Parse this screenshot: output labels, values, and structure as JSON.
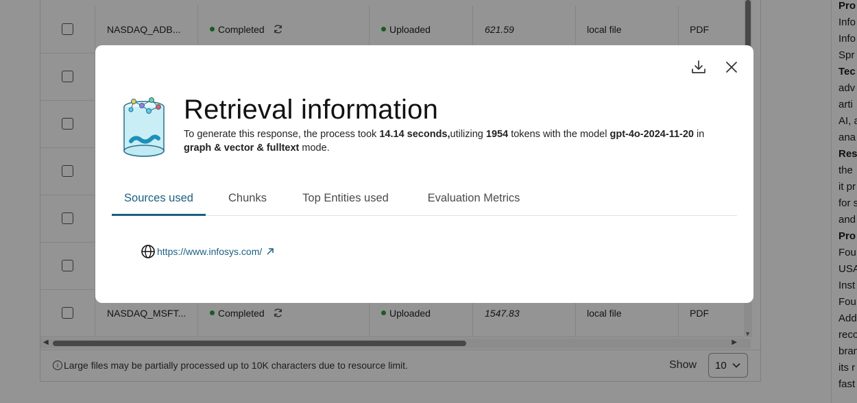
{
  "table": {
    "rows": [
      {
        "checked": false,
        "name": "NASDAQ_ADB...",
        "status": "Completed",
        "upload": "Uploaded",
        "size": "621.59",
        "source": "local file",
        "type": "PDF"
      },
      {
        "checked": false,
        "name": "",
        "status": "",
        "upload": "",
        "size": "",
        "source": "",
        "type": ""
      },
      {
        "checked": false,
        "name": "",
        "status": "",
        "upload": "",
        "size": "",
        "source": "",
        "type": ""
      },
      {
        "checked": false,
        "name": "",
        "status": "",
        "upload": "",
        "size": "",
        "source": "",
        "type": ""
      },
      {
        "checked": false,
        "name": "",
        "status": "",
        "upload": "",
        "size": "",
        "source": "",
        "type": ""
      },
      {
        "checked": false,
        "name": "",
        "status": "",
        "upload": "",
        "size": "",
        "source": "",
        "type": ""
      },
      {
        "checked": false,
        "name": "NASDAQ_MSFT...",
        "status": "Completed",
        "upload": "Uploaded",
        "size": "1547.83",
        "source": "local file",
        "type": "PDF"
      }
    ],
    "status_color": "#2e9e3f"
  },
  "footer": {
    "note": "Large files may be partially processed up to 10K characters due to resource limit.",
    "show_label": "Show",
    "page_size": "10"
  },
  "right_panel": {
    "lines": [
      {
        "text": "Pro",
        "bold": true
      },
      {
        "text": "Info",
        "bold": false
      },
      {
        "text": "Info",
        "bold": false
      },
      {
        "text": "Spr",
        "bold": false
      },
      {
        "text": "Tec",
        "bold": true
      },
      {
        "text": "adv",
        "bold": false
      },
      {
        "text": "arti",
        "bold": false
      },
      {
        "text": "AI, a",
        "bold": false
      },
      {
        "text": "ana",
        "bold": false
      },
      {
        "text": "Res",
        "bold": true
      },
      {
        "text": "the",
        "bold": false
      },
      {
        "text": "it pr",
        "bold": false
      },
      {
        "text": "for s",
        "bold": false
      },
      {
        "text": "and",
        "bold": false
      },
      {
        "text": "Pro",
        "bold": true
      },
      {
        "text": "Fou",
        "bold": false
      },
      {
        "text": "USA",
        "bold": false
      },
      {
        "text": "Inst",
        "bold": false
      },
      {
        "text": "Fou",
        "bold": false
      },
      {
        "text": "Add",
        "bold": false
      },
      {
        "text": "reco",
        "bold": false
      },
      {
        "text": "bran",
        "bold": false
      },
      {
        "text": "its r",
        "bold": false
      },
      {
        "text": "fast",
        "bold": false
      }
    ]
  },
  "modal": {
    "title": "Retrieval information",
    "desc": {
      "p1": "To generate this response, the process took ",
      "seconds": "14.14 seconds,",
      "p2": "utilizing ",
      "tokens": "1954",
      "p3": " tokens with the model ",
      "model": "gpt-4o-2024-11-20",
      "p4": " in ",
      "mode": "graph & vector & fulltext",
      "p5": " mode."
    },
    "tabs": [
      {
        "label": "Sources used",
        "active": true
      },
      {
        "label": "Chunks",
        "active": false
      },
      {
        "label": "Top Entities used",
        "active": false
      },
      {
        "label": "Evaluation Metrics",
        "active": false
      }
    ],
    "sources": [
      {
        "url": "https://www.infosys.com/"
      }
    ],
    "accent": "#1a5f80"
  }
}
